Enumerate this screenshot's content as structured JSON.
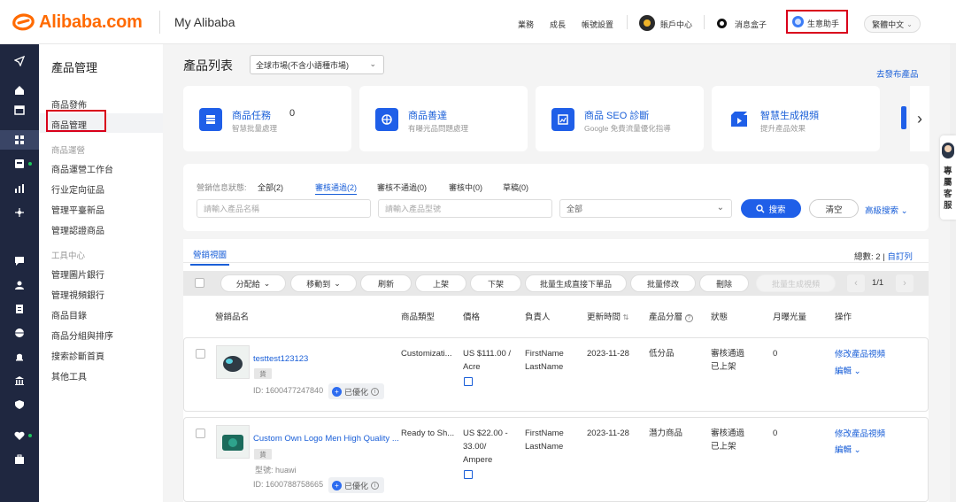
{
  "header": {
    "brand": "Alibaba.com",
    "subtitle": "My Alibaba",
    "links": [
      "業務",
      "成長",
      "帳號設置"
    ],
    "account_center": "賬戶中心",
    "message_box": "消息盒子",
    "assistant": "生意助手",
    "language": "繁體中文"
  },
  "sidebar": {
    "title": "產品管理",
    "items": [
      "商品發佈",
      "商品管理"
    ],
    "group1_title": "商品運營",
    "group1_items": [
      "商品運營工作台",
      "行业定向征品",
      "管理平臺新品",
      "管理認證商品"
    ],
    "group2_title": "工具中心",
    "group2_items": [
      "管理圖片銀行",
      "管理視頻銀行",
      "商品目錄",
      "商品分組與排序",
      "搜索診斷首頁",
      "其他工具"
    ]
  },
  "page": {
    "title": "產品列表",
    "market_select": "全球市場(不含小語種市場)",
    "goto_link": "去發布產品"
  },
  "cards": [
    {
      "title": "商品任務",
      "subtitle": "智慧批量處理",
      "count": "0",
      "icon": "task-icon"
    },
    {
      "title": "商品善達",
      "subtitle": "有曝光品問題處理",
      "icon": "globe-icon"
    },
    {
      "title": "商品 SEO 診斷",
      "subtitle": "Google 免費流量優化指導",
      "icon": "seo-icon"
    },
    {
      "title": "智慧生成視頻",
      "subtitle": "提升產品效果",
      "icon": "video-icon"
    }
  ],
  "filter": {
    "status_label": "營銷信息狀態:",
    "tabs": [
      "全部(2)",
      "審核通過(2)",
      "審核不通過(0)",
      "審核中(0)",
      "草稿(0)"
    ],
    "name_placeholder": "請輸入產品名稱",
    "model_placeholder": "請輸入產品型號",
    "select_value": "全部",
    "search": "搜索",
    "clear": "清空",
    "advanced": "高級搜索"
  },
  "table": {
    "tab": "營銷視圖",
    "total_label": "總數: 2",
    "custom_columns": "自訂列",
    "actions": [
      "分配給",
      "移動到",
      "刷新",
      "上架",
      "下架",
      "批量生成直接下單品",
      "批量修改",
      "刪除",
      "批量生成視頻"
    ],
    "pagination": "1/1",
    "columns": [
      "營銷品名",
      "商品類型",
      "價格",
      "負責人",
      "更新時間",
      "產品分層",
      "狀態",
      "月曝光量",
      "操作"
    ],
    "rows": [
      {
        "name": "testtest123123",
        "badge": "貨",
        "model": "",
        "id": "ID: 1600477247840",
        "optimized": "已優化",
        "type": "Customizati...",
        "price_line1": "US $111.00 /",
        "price_line2": "Acre",
        "owner_first": "FirstName",
        "owner_last": "LastName",
        "updated": "2023-11-28",
        "tier": "低分品",
        "status1": "審核通過",
        "status2": "已上架",
        "exposure": "0",
        "action1": "修改產品視頻",
        "action2": "編輯"
      },
      {
        "name": "Custom Own Logo Men High Quality ...",
        "badge": "貨",
        "model": "型號: huawi",
        "id": "ID: 1600788758665",
        "optimized": "已優化",
        "type": "Ready to Sh...",
        "price_line1": "US $22.00 -",
        "price_line2": "33.00/",
        "price_line3": "Ampere",
        "owner_first": "FirstName",
        "owner_last": "LastName",
        "updated": "2023-11-28",
        "tier": "潛力商品",
        "status1": "審核通過",
        "status2": "已上架",
        "exposure": "0",
        "action1": "修改產品視頻",
        "action2": "編輯"
      }
    ]
  },
  "float_service": "專屬客服",
  "colors": {
    "brand": "#ff6a00",
    "primary": "#1f5fe8",
    "highlight": "#d9001b",
    "sidebar": "#1f2740"
  }
}
